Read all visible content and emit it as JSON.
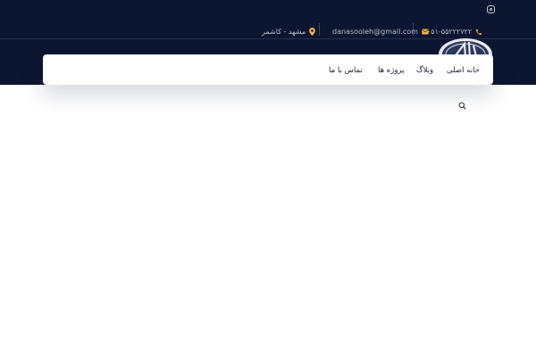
{
  "topbar": {
    "phone": "۰۵۱-۵۵۲۲۲۷۲۲",
    "email": "danasooleh@gmail.com",
    "address": "مشهد - کاشمر",
    "icons": {
      "phone": "phone-icon",
      "email": "envelope-icon",
      "address": "map-pin-icon",
      "social": "instagram-icon"
    },
    "accent_color": "#f3b43d"
  },
  "nav": {
    "items": [
      {
        "label": "خانه اصلی"
      },
      {
        "label": "وبلاگ"
      },
      {
        "label": "پروژه ها"
      },
      {
        "label": "تماس با ما"
      }
    ],
    "search_icon": "search-icon"
  },
  "colors": {
    "header_bg": "#0c1631",
    "page_bg": "#ffffff"
  }
}
